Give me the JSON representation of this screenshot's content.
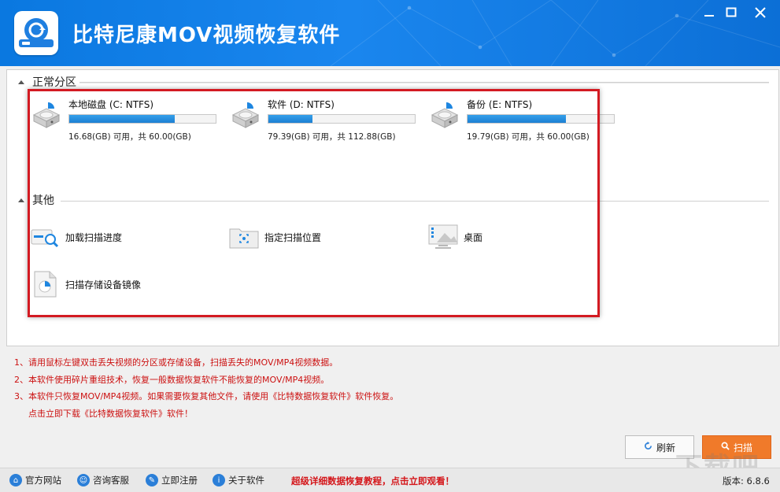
{
  "window": {
    "title": "比特尼康MOV视频恢复软件",
    "minimize_label": "—",
    "maximize_label": "☐",
    "close_label": "✕"
  },
  "sections": {
    "normal_title": "正常分区",
    "other_title": "其他"
  },
  "drives": [
    {
      "name": "本地磁盘 (C: NTFS)",
      "usage_fraction": 0.72,
      "size_text": "16.68(GB) 可用，共 60.00(GB)"
    },
    {
      "name": "软件 (D: NTFS)",
      "usage_fraction": 0.3,
      "size_text": "79.39(GB) 可用，共 112.88(GB)"
    },
    {
      "name": "备份 (E: NTFS)",
      "usage_fraction": 0.67,
      "size_text": "19.79(GB) 可用，共 60.00(GB)"
    }
  ],
  "others": [
    {
      "label": "加载扫描进度",
      "icon": "load-progress-icon"
    },
    {
      "label": "指定扫描位置",
      "icon": "folder-target-icon"
    },
    {
      "label": "桌面",
      "icon": "desktop-icon"
    },
    {
      "label": "扫描存储设备镜像",
      "icon": "disk-image-icon"
    }
  ],
  "notes": [
    "1、请用鼠标左键双击丢失视频的分区或存储设备，扫描丢失的MOV/MP4视频数据。",
    "2、本软件使用碎片重组技术，恢复一般数据恢复软件不能恢复的MOV/MP4视频。",
    "3、本软件只恢复MOV/MP4视频。如果需要恢复其他文件，请使用《比特数据恢复软件》软件恢复。",
    "点击立即下载《比特数据恢复软件》软件！"
  ],
  "buttons": {
    "refresh": "刷新",
    "scan": "扫描"
  },
  "footer": {
    "items": [
      "官方网站",
      "咨询客服",
      "立即注册",
      "关于软件"
    ],
    "promo": "超级详细数据恢复教程，点击立即观看！",
    "version": "版本: 6.8.6"
  },
  "colors": {
    "title_bar": "#0a78e0",
    "highlight_border": "#d31a22",
    "note_text": "#cc1111",
    "scan_button": "#f07a2a",
    "usage_bar": "#1c7fd3"
  }
}
